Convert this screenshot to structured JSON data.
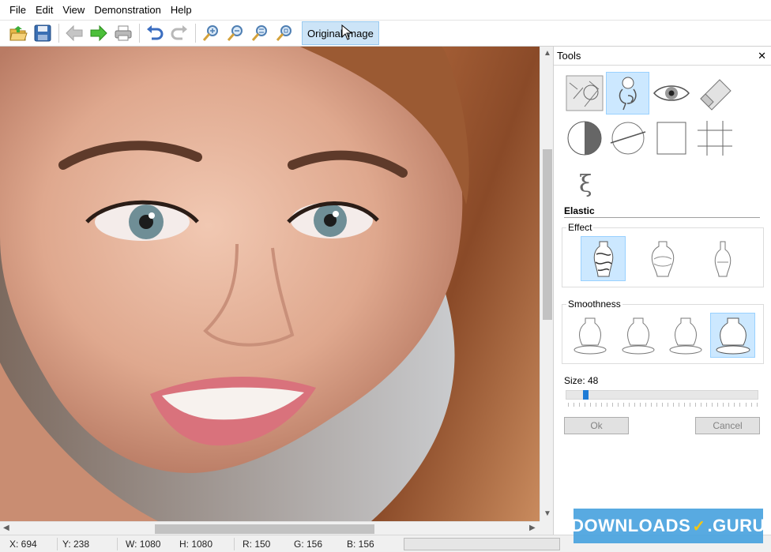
{
  "menu": [
    "File",
    "Edit",
    "View",
    "Demonstration",
    "Help"
  ],
  "toolbar": {
    "icons": [
      "open-icon",
      "save-icon",
      "back-icon",
      "forward-icon",
      "print-icon",
      "undo-icon",
      "redo-icon",
      "zoom-in-icon",
      "zoom-out-icon",
      "zoom-fit-icon",
      "zoom-actual-icon"
    ],
    "original_label": "Original image"
  },
  "panel": {
    "title": "Tools",
    "close": "✕",
    "section": "Elastic",
    "effect_label": "Effect",
    "smoothness_label": "Smoothness",
    "size_label": "Size: 48",
    "size_value": 48,
    "ok_label": "Ok",
    "cancel_label": "Cancel"
  },
  "status": {
    "x": "X: 694",
    "y": "Y: 238",
    "w": "W: 1080",
    "h": "H: 1080",
    "r": "R: 150",
    "g": "G: 156",
    "b": "B: 156"
  },
  "watermark": {
    "left": "DOWNLOADS",
    "right": "GURU",
    "dot": "."
  }
}
